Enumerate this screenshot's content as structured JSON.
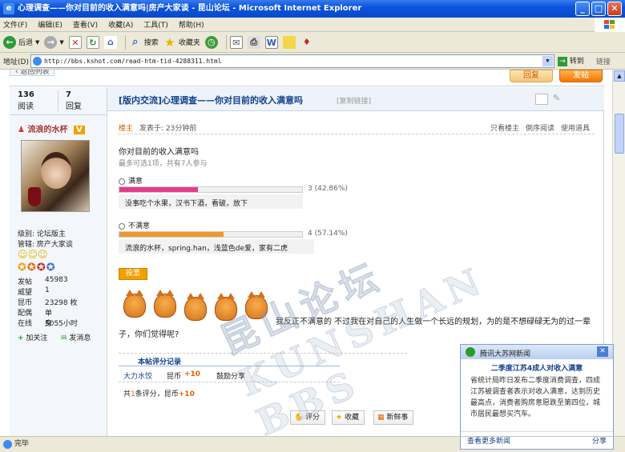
{
  "window": {
    "title": "心理调查——你对目前的收入满意吗|房产大家谈 - 昆山论坛 - Microsoft Internet Explorer",
    "min": "_",
    "max": "□",
    "close": "✕"
  },
  "menu": [
    "文件(F)",
    "编辑(E)",
    "查看(V)",
    "收藏(A)",
    "工具(T)",
    "帮助(H)"
  ],
  "toolbar": {
    "back": "后退",
    "search": "搜索",
    "favorites": "收藏夹"
  },
  "address": {
    "label": "地址(D)",
    "url": "http://bbs.kshot.com/read-htm-tid-4288311.html",
    "go": "转到",
    "links": "链接"
  },
  "page": {
    "back_list": "‹ 返回列表",
    "reply": "回复",
    "post": "发帖",
    "views_num": "136",
    "views_label": "阅读",
    "replies_num": "7",
    "replies_label": "回复",
    "thread_title": "[版内交流]心理调查——你对目前的收入满意吗",
    "copy_link": "[复制链接]",
    "user": {
      "name": "流浪的水杯",
      "badge": "V",
      "level": "级别: 论坛版主",
      "manage": "管辖: 房产大家谈",
      "stats": [
        {
          "k": "发帖",
          "v": "45983"
        },
        {
          "k": "威望",
          "v": "1"
        },
        {
          "k": "昆币",
          "v": "23298 枚"
        },
        {
          "k": "配偶",
          "v": "单身"
        },
        {
          "k": "在线",
          "v": "5055小时"
        }
      ],
      "follow": "加关注",
      "message": "发消息"
    },
    "post_meta": {
      "owner": "楼主",
      "posted": "发表于: 23分钟前",
      "only_owner": "只看楼主",
      "reverse": "倒序阅读",
      "tools": "使用道具"
    },
    "poll": {
      "question": "你对目前的收入满意吗",
      "hint": "最多可选1项，共有7人参与",
      "options": [
        {
          "label": "满意",
          "result": "3 (42.86%)",
          "value": 42.86,
          "voters": "没事吃个水果，汉书下酒，看破，放下",
          "color": "#e23f86"
        },
        {
          "label": "不满意",
          "result": "4 (57.14%)",
          "value": 57.14,
          "voters": "流浪的水杯，spring.han，浅蓝色de爱，家有二虎",
          "color": "#f0972a"
        }
      ],
      "vote_btn": "投票"
    },
    "body_text": "我反正不满意的  不过我在对自己的人生做一个长远的规划，为的是不想碌碌无为的过一辈子，你们觉得呢?",
    "rating": {
      "title": "本帖评分记录",
      "user": "大力水饺",
      "currency": "昆币",
      "amount": "+10",
      "note": "鼓励分享",
      "total_prefix": "共",
      "total_count": "1",
      "total_mid": "条评分，昆币",
      "total_amount": "+10"
    },
    "actions": {
      "rate": "评分",
      "fav": "收藏",
      "new": "新鲜事"
    }
  },
  "popup": {
    "source": "腾讯大苏网新闻",
    "headline": "二季度江苏4成人对收入满意",
    "text": "省统计局昨日发布二季度消费调查，四成江苏被调查者表示对收入满意，达到历史最高点，消费者购房意愿跌至第四位，城市居民最想买汽车。",
    "more": "查看更多新闻",
    "share": "分享"
  },
  "watermark": "昆山论坛 KUNSHAN BBS",
  "status": "完毕"
}
